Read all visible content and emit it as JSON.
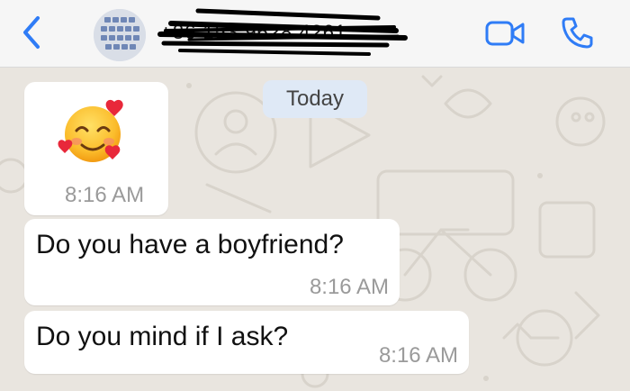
{
  "header": {
    "back_icon": "chevron-left-icon",
    "avatar_icon": "contact-photo",
    "phone_number": "+86 153 9628 4261",
    "video_icon": "video-camera-icon",
    "call_icon": "phone-icon",
    "accent_color": "#2f7cf6"
  },
  "chat": {
    "date_label": "Today",
    "messages": [
      {
        "type": "emoji",
        "emoji_icon": "smiling-face-with-hearts-emoji",
        "time": "8:16 AM"
      },
      {
        "type": "text",
        "text": "Do you have a boyfriend?",
        "time": "8:16 AM"
      },
      {
        "type": "text",
        "text": "Do you mind if I ask?",
        "time": "8:16 AM"
      }
    ]
  }
}
